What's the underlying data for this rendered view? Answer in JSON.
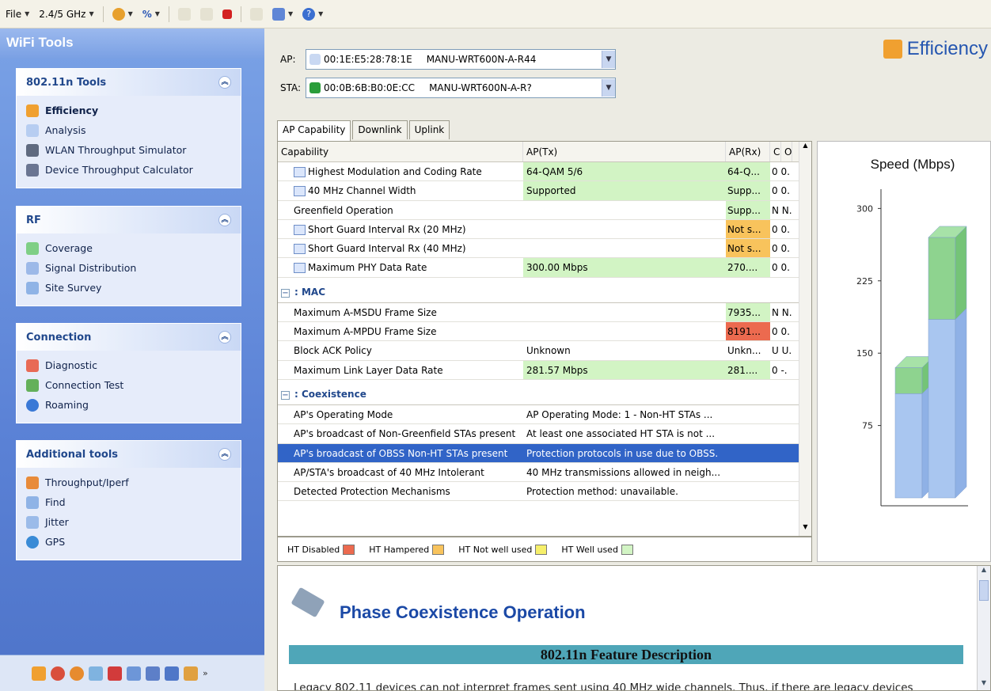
{
  "toolbar": {
    "file_label": "File",
    "band_label": "2.4/5 GHz"
  },
  "sidebar": {
    "title": "WiFi Tools",
    "groups": [
      {
        "title": "802.11n Tools",
        "items": [
          "Efficiency",
          "Analysis",
          "WLAN Throughput Simulator",
          "Device Throughput Calculator"
        ]
      },
      {
        "title": "RF",
        "items": [
          "Coverage",
          "Signal Distribution",
          "Site Survey"
        ]
      },
      {
        "title": "Connection",
        "items": [
          "Diagnostic",
          "Connection Test",
          "Roaming"
        ]
      },
      {
        "title": "Additional tools",
        "items": [
          "Throughput/Iperf",
          "Find",
          "Jitter",
          "GPS"
        ]
      }
    ]
  },
  "header": {
    "title": "Efficiency",
    "ap_label": "AP:",
    "ap_mac": "00:1E:E5:28:78:1E",
    "ap_name": "MANU-WRT600N-A-R44",
    "sta_label": "STA:",
    "sta_mac": "00:0B:6B:B0:0E:CC",
    "sta_name": "MANU-WRT600N-A-R?"
  },
  "tabs": [
    "AP Capability",
    "Downlink",
    "Uplink"
  ],
  "grid": {
    "columns": [
      "Capability",
      "AP(Tx)",
      "AP(Rx)",
      "C",
      "O"
    ],
    "rows1": [
      [
        "Highest Modulation and Coding Rate",
        "64-QAM 5/6",
        "64-Q...",
        "0 0."
      ],
      [
        "40 MHz Channel Width",
        "Supported",
        "Supp...",
        "0 0."
      ],
      [
        "Greenfield Operation",
        "",
        "Supp...",
        "N N."
      ],
      [
        "Short Guard Interval Rx (20 MHz)",
        "",
        "Not s...",
        "0 0."
      ],
      [
        "Short Guard Interval Rx (40 MHz)",
        "",
        "Not s...",
        "0 0."
      ],
      [
        "Maximum PHY Data Rate",
        "300.00 Mbps",
        "270....",
        "0 0."
      ]
    ],
    "section_mac": ": MAC",
    "rows2": [
      [
        "Maximum A-MSDU Frame Size",
        "",
        "7935...",
        "N N."
      ],
      [
        "Maximum A-MPDU Frame Size",
        "",
        "8191...",
        "0 0."
      ],
      [
        "Block ACK Policy",
        "Unknown",
        "Unkn...",
        "U U."
      ],
      [
        "Maximum Link Layer Data Rate",
        "281.57 Mbps",
        "281....",
        "0 -."
      ]
    ],
    "section_coex": ": Coexistence",
    "rows3": [
      [
        "AP's Operating Mode",
        "AP Operating Mode: 1 - Non-HT STAs ..."
      ],
      [
        "AP's broadcast of Non-Greenfield STAs present",
        "At least one associated HT STA is not ..."
      ],
      [
        "AP's broadcast of OBSS Non-HT STAs present",
        "Protection protocols in use due to OBSS."
      ],
      [
        "AP/STA's broadcast of 40 MHz Intolerant",
        "40 MHz transmissions allowed in neigh..."
      ],
      [
        "Detected Protection Mechanisms",
        "Protection method: unavailable."
      ]
    ]
  },
  "legend": [
    "HT Disabled",
    "HT Hampered",
    "HT Not well used",
    "HT Well used"
  ],
  "colors": {
    "disabled": "#ec6a4f",
    "hampered": "#f8c35c",
    "not_well": "#f6ef6a",
    "well": "#d2f4c4"
  },
  "chart_data": {
    "type": "bar",
    "title": "Speed (Mbps)",
    "yticks": [
      "300",
      "225",
      "150",
      "75"
    ],
    "ylim": [
      0,
      320
    ],
    "categories": [
      "",
      ""
    ],
    "series": [
      {
        "values": [
          108,
          185
        ]
      },
      {
        "values": [
          27,
          85
        ]
      }
    ]
  },
  "doc": {
    "heading": "Phase Coexistence Operation",
    "banner": "802.11n Feature Description",
    "text": "Legacy 802.11 devices can not interpret frames sent using 40 MHz wide channels. Thus, if there are legacy devices"
  }
}
